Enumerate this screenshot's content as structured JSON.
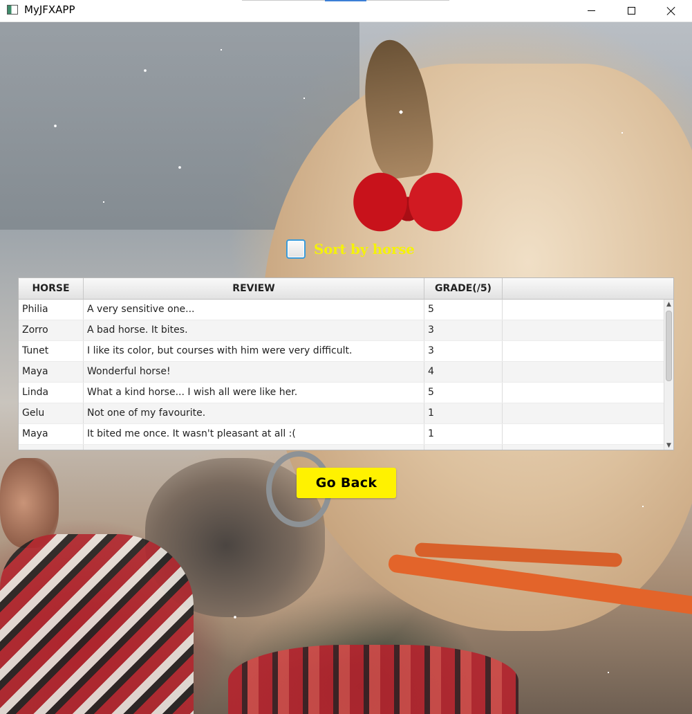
{
  "window": {
    "title": "MyJFXAPP"
  },
  "sort": {
    "label": "Sort by horse",
    "checked": false
  },
  "table": {
    "columns": [
      "HORSE",
      "REVIEW",
      "GRADE(/5)",
      ""
    ],
    "rows": [
      {
        "horse": "Philia",
        "review": "A very sensitive one...",
        "grade": "5"
      },
      {
        "horse": "Zorro",
        "review": "A bad horse. It bites.",
        "grade": "3"
      },
      {
        "horse": "Tunet",
        "review": "I like its color, but courses with him were very difficult.",
        "grade": "3"
      },
      {
        "horse": "Maya",
        "review": "Wonderful horse!",
        "grade": "4"
      },
      {
        "horse": "Linda",
        "review": "What a kind horse... I wish all were like her.",
        "grade": "5"
      },
      {
        "horse": "Gelu",
        "review": "Not one of my favourite.",
        "grade": "1"
      },
      {
        "horse": "Maya",
        "review": "It bited me once. It wasn't pleasant at all :(",
        "grade": "1"
      },
      {
        "horse": "",
        "review": "",
        "grade": ""
      }
    ]
  },
  "buttons": {
    "go_back": "Go Back"
  },
  "colors": {
    "accent_yellow": "#fff200",
    "label_yellow": "#f5f20a",
    "checkbox_border": "#3a9bd9"
  },
  "icons": {
    "app": "app-icon",
    "minimize": "minimize-icon",
    "maximize": "maximize-icon",
    "close": "close-icon",
    "scroll_up": "chevron-up-icon",
    "scroll_down": "chevron-down-icon"
  }
}
